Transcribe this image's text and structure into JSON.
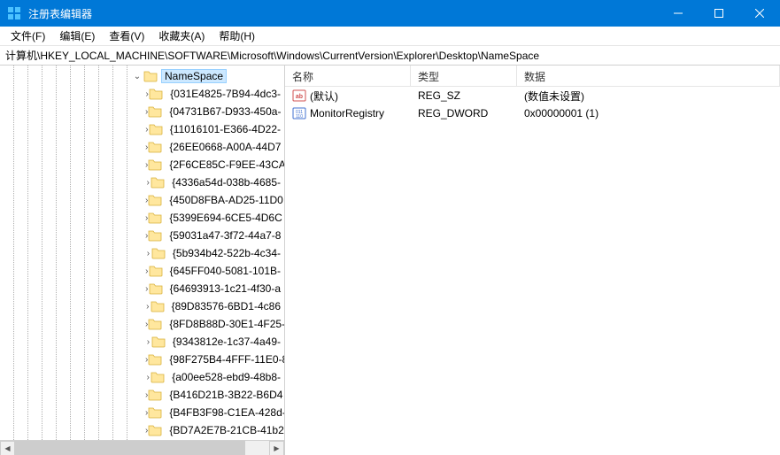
{
  "window": {
    "title": "注册表编辑器"
  },
  "menu": {
    "file": "文件(F)",
    "edit": "编辑(E)",
    "view": "查看(V)",
    "favorites": "收藏夹(A)",
    "help": "帮助(H)"
  },
  "address": "计算机\\HKEY_LOCAL_MACHINE\\SOFTWARE\\Microsoft\\Windows\\CurrentVersion\\Explorer\\Desktop\\NameSpace",
  "tree": {
    "selected": "NameSpace",
    "children": [
      "{031E4825-7B94-4dc3-",
      "{04731B67-D933-450a-",
      "{11016101-E366-4D22-",
      "{26EE0668-A00A-44D7",
      "{2F6CE85C-F9EE-43CA-",
      "{4336a54d-038b-4685-",
      "{450D8FBA-AD25-11D0",
      "{5399E694-6CE5-4D6C",
      "{59031a47-3f72-44a7-8",
      "{5b934b42-522b-4c34-",
      "{645FF040-5081-101B-",
      "{64693913-1c21-4f30-a",
      "{89D83576-6BD1-4c86",
      "{8FD8B88D-30E1-4F25-",
      "{9343812e-1c37-4a49-",
      "{98F275B4-4FFF-11E0-8",
      "{a00ee528-ebd9-48b8-",
      "{B416D21B-3B22-B6D4",
      "{B4FB3F98-C1EA-428d-",
      "{BD7A2E7B-21CB-41b2"
    ]
  },
  "list": {
    "headers": {
      "name": "名称",
      "type": "类型",
      "data": "数据"
    },
    "rows": [
      {
        "icon": "string",
        "name": "(默认)",
        "type": "REG_SZ",
        "data": "(数值未设置)"
      },
      {
        "icon": "binary",
        "name": "MonitorRegistry",
        "type": "REG_DWORD",
        "data": "0x00000001 (1)"
      }
    ]
  }
}
